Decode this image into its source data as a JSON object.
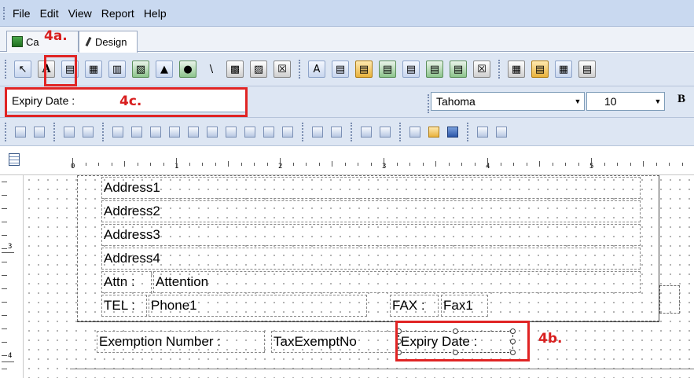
{
  "menu": [
    "File",
    "Edit",
    "View",
    "Report",
    "Help"
  ],
  "tabs": [
    {
      "label": "Ca"
    },
    {
      "label": "Design"
    }
  ],
  "toolbar": {
    "textbox_value": "Expiry Date :",
    "font_name": "Tahoma",
    "font_size": "10",
    "bold_label": "B"
  },
  "ruler": {
    "marks": [
      "0",
      "1",
      "2",
      "3",
      "4",
      "5"
    ]
  },
  "vruler": {
    "marks": [
      "3",
      "4"
    ]
  },
  "report": {
    "address1": "Address1",
    "address2": "Address2",
    "address3": "Address3",
    "address4": "Address4",
    "attn_label": "Attn :",
    "attn_value": "Attention",
    "tel_label": "TEL :",
    "tel_value": "Phone1",
    "fax_label": "FAX :",
    "fax_value": "Fax1",
    "exemption_label": "Exemption Number :",
    "exemption_value": "TaxExemptNo",
    "expiry_label": "Expiry Date :"
  },
  "annotations": {
    "a": "4a.",
    "b": "4b.",
    "c": "4c."
  },
  "colors": {
    "annotation": "#e02424",
    "menubar": "#c9d9f0"
  }
}
